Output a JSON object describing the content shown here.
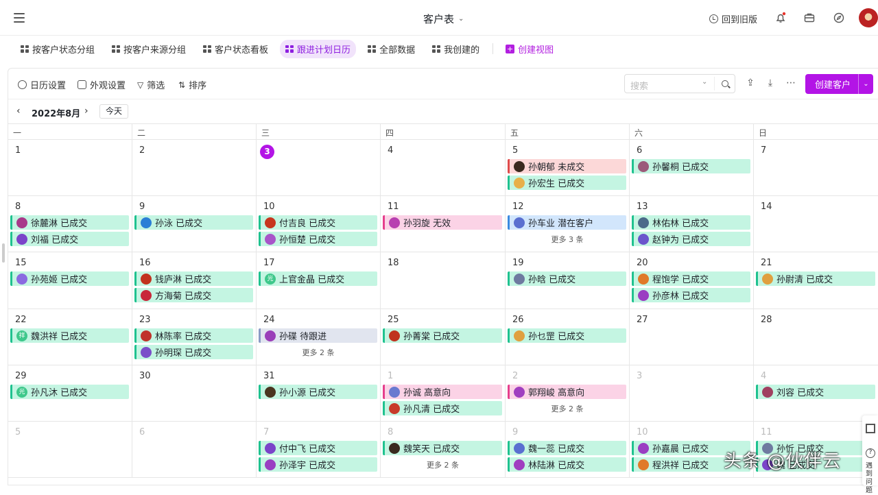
{
  "header": {
    "title": "客户表",
    "old_version": "回到旧版"
  },
  "tabs": [
    {
      "label": "按客户状态分组"
    },
    {
      "label": "按客户来源分组"
    },
    {
      "label": "客户状态看板"
    },
    {
      "label": "跟进计划日历"
    },
    {
      "label": "全部数据"
    },
    {
      "label": "我创建的"
    }
  ],
  "create_view": "创建视图",
  "toolbar": {
    "calendar_settings": "日历设置",
    "appearance": "外观设置",
    "filter": "筛选",
    "sort": "排序",
    "search_placeholder": "搜索",
    "create_customer": "创建客户"
  },
  "nav": {
    "month": "2022年8月",
    "today": "今天"
  },
  "weekdays": [
    "一",
    "二",
    "三",
    "四",
    "五",
    "六",
    "日"
  ],
  "weeks": [
    [
      {
        "d": "1",
        "events": []
      },
      {
        "d": "2",
        "events": []
      },
      {
        "d": "3",
        "today": true,
        "events": []
      },
      {
        "d": "4",
        "events": []
      },
      {
        "d": "5",
        "events": [
          {
            "t": "孙朝郁 未成交",
            "c": "red",
            "a": "#3a2a1f"
          },
          {
            "t": "孙宏生 已成交",
            "c": "green",
            "a": "#e8b04a"
          }
        ]
      },
      {
        "d": "6",
        "events": [
          {
            "t": "孙馨桐 已成交",
            "c": "green",
            "a": "#9b5b7a"
          }
        ]
      },
      {
        "d": "7",
        "events": []
      }
    ],
    [
      {
        "d": "8",
        "events": [
          {
            "t": "徐麓淋 已成交",
            "c": "green",
            "a": "#a8398a"
          },
          {
            "t": "刘福 已成交",
            "c": "green",
            "a": "#7b44c9"
          }
        ]
      },
      {
        "d": "9",
        "events": [
          {
            "t": "孙泳 已成交",
            "c": "green",
            "a": "#2b7fd6"
          }
        ]
      },
      {
        "d": "10",
        "events": [
          {
            "t": "付吉良 已成交",
            "c": "green",
            "a": "#c7361f"
          },
          {
            "t": "孙恒楚 已成交",
            "c": "green",
            "a": "#a855c9"
          }
        ]
      },
      {
        "d": "11",
        "events": [
          {
            "t": "孙羽旋 无效",
            "c": "pink",
            "a": "#b83fb0"
          }
        ]
      },
      {
        "d": "12",
        "events": [
          {
            "t": "孙车业 潜在客户",
            "c": "blue",
            "a": "#5a6fd0"
          }
        ],
        "more": "更多 3 条"
      },
      {
        "d": "13",
        "events": [
          {
            "t": "林佑林 已成交",
            "c": "green",
            "a": "#4b6a8a"
          },
          {
            "t": "赵钟为 已成交",
            "c": "green",
            "a": "#6b55cc"
          }
        ]
      },
      {
        "d": "14",
        "events": []
      }
    ],
    [
      {
        "d": "15",
        "events": [
          {
            "t": "孙苑姬 已成交",
            "c": "green",
            "a": "#8a6ae0"
          }
        ]
      },
      {
        "d": "16",
        "events": [
          {
            "t": "钱庐淋 已成交",
            "c": "green",
            "a": "#c2331f"
          },
          {
            "t": "方海菊 已成交",
            "c": "green",
            "a": "#c8283a"
          }
        ]
      },
      {
        "d": "17",
        "events": [
          {
            "t": "上官金晶 已成交",
            "c": "green",
            "a": "#3ec88b",
            "txt": "光"
          }
        ]
      },
      {
        "d": "18",
        "events": []
      },
      {
        "d": "19",
        "events": [
          {
            "t": "孙晗 已成交",
            "c": "green",
            "a": "#6f7aa0"
          }
        ]
      },
      {
        "d": "20",
        "events": [
          {
            "t": "程饱学 已成交",
            "c": "green",
            "a": "#e07a2a"
          },
          {
            "t": "孙彦林 已成交",
            "c": "green",
            "a": "#9a3fc2"
          }
        ]
      },
      {
        "d": "21",
        "events": [
          {
            "t": "孙尉清 已成交",
            "c": "green",
            "a": "#e0a040"
          }
        ]
      }
    ],
    [
      {
        "d": "22",
        "events": [
          {
            "t": "魏洪祥 已成交",
            "c": "green",
            "a": "#3ec88b",
            "txt": "祥"
          }
        ]
      },
      {
        "d": "23",
        "events": [
          {
            "t": "林陈率 已成交",
            "c": "green",
            "a": "#c0322a"
          },
          {
            "t": "孙明琛 已成交",
            "c": "green",
            "a": "#7b4fc9"
          }
        ]
      },
      {
        "d": "24",
        "events": [
          {
            "t": "孙碟 待跟进",
            "c": "gray",
            "a": "#9b3fb9"
          }
        ],
        "more": "更多 2 条"
      },
      {
        "d": "25",
        "events": [
          {
            "t": "孙菁棠 已成交",
            "c": "green",
            "a": "#c0321f"
          }
        ]
      },
      {
        "d": "26",
        "events": [
          {
            "t": "孙乜罡 已成交",
            "c": "green",
            "a": "#e0a040"
          }
        ]
      },
      {
        "d": "27",
        "events": []
      },
      {
        "d": "28",
        "events": []
      }
    ],
    [
      {
        "d": "29",
        "events": [
          {
            "t": "孙凡沐 已成交",
            "c": "green",
            "a": "#3ec88b",
            "txt": "光"
          }
        ]
      },
      {
        "d": "30",
        "events": []
      },
      {
        "d": "31",
        "events": [
          {
            "t": "孙小源 已成交",
            "c": "green",
            "a": "#4a3520"
          }
        ]
      },
      {
        "d": "1",
        "dim": true,
        "events": [
          {
            "t": "孙诚 高意向",
            "c": "pink",
            "a": "#6a7ad0"
          },
          {
            "t": "孙凡清 已成交",
            "c": "green",
            "a": "#c83a2a"
          }
        ]
      },
      {
        "d": "2",
        "dim": true,
        "events": [
          {
            "t": "郭翔峻 高意向",
            "c": "pink",
            "a": "#a03fc0"
          }
        ],
        "more": "更多 2 条"
      },
      {
        "d": "3",
        "dim": true,
        "events": []
      },
      {
        "d": "4",
        "dim": true,
        "events": [
          {
            "t": "刘容 已成交",
            "c": "green",
            "a": "#a04060"
          }
        ]
      }
    ],
    [
      {
        "d": "5",
        "dim": true,
        "events": []
      },
      {
        "d": "6",
        "dim": true,
        "events": []
      },
      {
        "d": "7",
        "dim": true,
        "events": [
          {
            "t": "付中飞 已成交",
            "c": "green",
            "a": "#7b44c9"
          },
          {
            "t": "孙泽宇 已成交",
            "c": "green",
            "a": "#9a3fc2"
          }
        ]
      },
      {
        "d": "8",
        "dim": true,
        "events": [
          {
            "t": "魏笑天 已成交",
            "c": "green",
            "a": "#3a2a1f"
          }
        ],
        "more": "更多 2 条"
      },
      {
        "d": "9",
        "dim": true,
        "events": [
          {
            "t": "魏一蕊 已成交",
            "c": "green",
            "a": "#5a6fd0"
          },
          {
            "t": "林陆淋 已成交",
            "c": "green",
            "a": "#a03fc0"
          }
        ]
      },
      {
        "d": "10",
        "dim": true,
        "events": [
          {
            "t": "孙嘉晨 已成交",
            "c": "green",
            "a": "#9a3fc2"
          },
          {
            "t": "程洪祥 已成交",
            "c": "green",
            "a": "#e07a2a"
          }
        ]
      },
      {
        "d": "11",
        "dim": true,
        "events": [
          {
            "t": "孙忻 已成交",
            "c": "green",
            "a": "#6f7aa0"
          },
          {
            "t": "魏 已成交",
            "c": "green",
            "a": "#7b44c9"
          }
        ]
      }
    ]
  ],
  "watermark": "头条 @伙伴云",
  "side_help": "遇到问题"
}
